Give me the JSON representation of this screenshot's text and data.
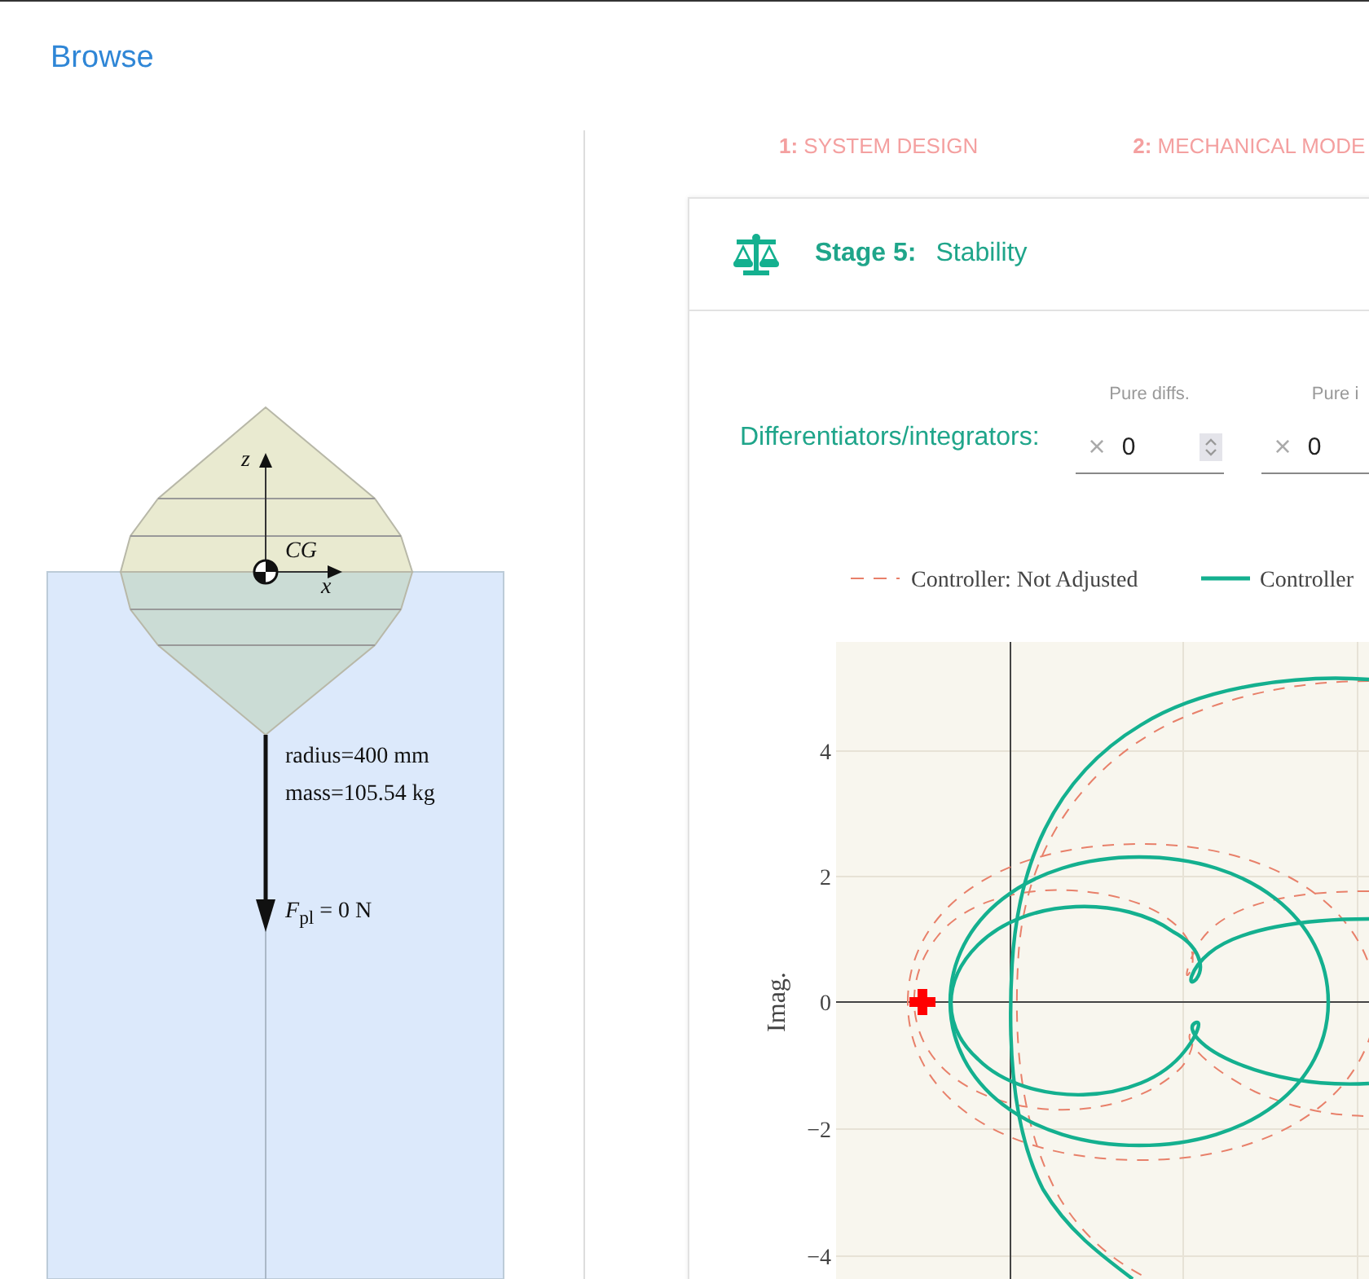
{
  "header": {
    "browse_link": "Browse"
  },
  "diagram": {
    "axis_z": "z",
    "axis_x": "x",
    "cg_label": "CG",
    "radius": "radius=400 mm",
    "mass": "mass=105.54 kg",
    "force": "*F*$_{pl}$ = 0 N"
  },
  "steps": [
    {
      "number": "1:",
      "label": "SYSTEM DESIGN"
    },
    {
      "number": "2:",
      "label": "MECHANICAL MODE"
    }
  ],
  "stage": {
    "title": "Stage 5:",
    "name": "Stability"
  },
  "controls": {
    "label": "Differentiators/integrators:",
    "fields": [
      {
        "label": "Pure diffs.",
        "clear": "×",
        "value": "0",
        "spinner": true
      },
      {
        "label": "Pure i",
        "clear": "×",
        "value": "0"
      }
    ]
  },
  "chart": {
    "legend": [
      {
        "name": "Controller: Not Adjusted",
        "kind": "dashed",
        "color": "#e8806a"
      },
      {
        "name": "Controller",
        "kind": "solid",
        "color": "#14b08f"
      }
    ],
    "ylabel": "Imag.",
    "yticks": [
      "4",
      "2",
      "0",
      "−2",
      "−4"
    ]
  }
}
